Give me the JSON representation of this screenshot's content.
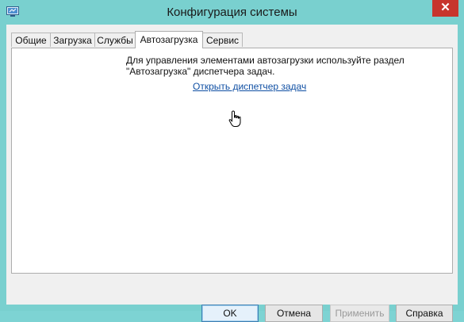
{
  "window": {
    "title": "Конфигурация системы",
    "close_glyph": "✕"
  },
  "tabs": [
    {
      "label": "Общие"
    },
    {
      "label": "Загрузка"
    },
    {
      "label": "Службы"
    },
    {
      "label": "Автозагрузка",
      "active": true
    },
    {
      "label": "Сервис"
    }
  ],
  "panel": {
    "description": "Для управления элементами автозагрузки используйте раздел\n\"Автозагрузка\" диспетчера задач.",
    "link_label": "Открыть диспетчер задач"
  },
  "buttons": {
    "ok": "OK",
    "cancel": "Отмена",
    "apply": "Применить",
    "help": "Справка"
  },
  "colors": {
    "title_bar": "#79d0cf",
    "close_button": "#c7352d",
    "link": "#0f4fa3"
  }
}
